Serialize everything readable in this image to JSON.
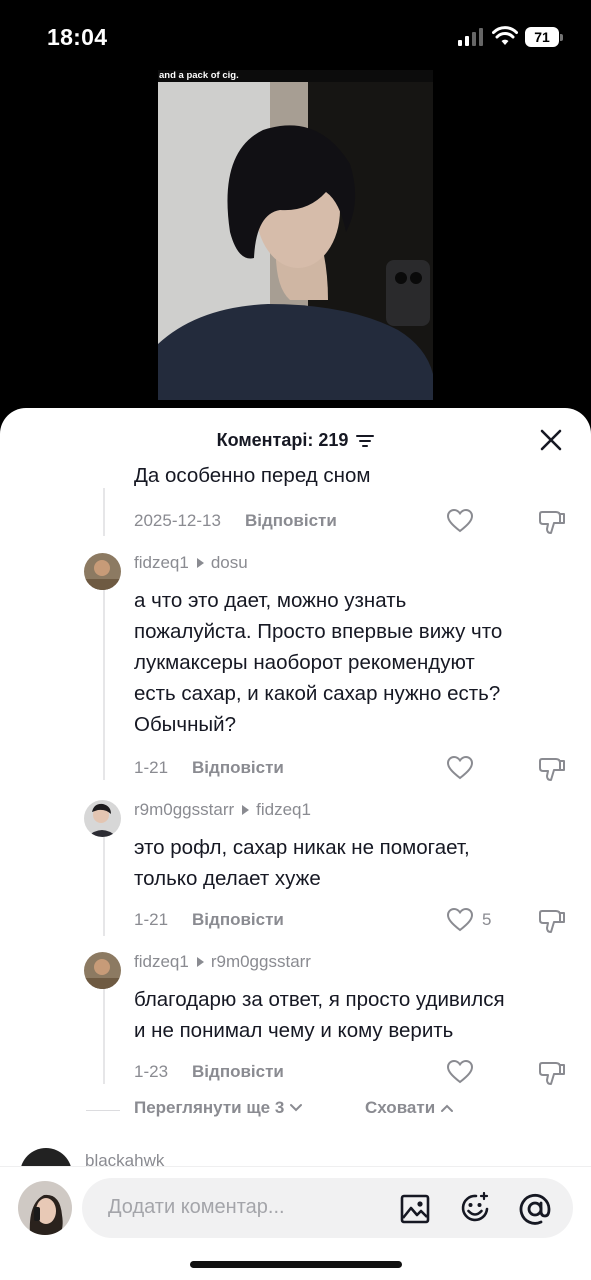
{
  "status_bar": {
    "time": "18:04",
    "battery": "71"
  },
  "video": {
    "caption": "and a pack of cig."
  },
  "comments_header": {
    "title": "Коментарі: 219"
  },
  "first_reply": {
    "text": "Да особенно перед сном",
    "date": "2025-12-13",
    "reply_label": "Відповісти"
  },
  "replies": [
    {
      "author": "fidzeq1",
      "reply_to": "dosu",
      "lines": [
        "а что это дает, можно узнать",
        "пожалуйста. Просто впервые вижу что",
        "лукмаксеры наоборот рекомендуют",
        "есть сахар, и какой сахар нужно есть?",
        "Обычный?"
      ],
      "date": "1-21",
      "reply_label": "Відповісти",
      "likes": ""
    },
    {
      "author": "r9m0ggsstarr",
      "reply_to": "fidzeq1",
      "lines": [
        "это рофл, сахар никак не помогает,",
        "только делает хуже"
      ],
      "date": "1-21",
      "reply_label": "Відповісти",
      "likes": "5"
    },
    {
      "author": "fidzeq1",
      "reply_to": "r9m0ggsstarr",
      "lines": [
        "благодарю за ответ, я просто удивился",
        "и не понимал чему и кому верить"
      ],
      "date": "1-23",
      "reply_label": "Відповісти",
      "likes": ""
    }
  ],
  "thread_controls": {
    "view_more": "Переглянути ще 3",
    "hide": "Сховати"
  },
  "next_comment": {
    "author": "blackahwk"
  },
  "input_bar": {
    "placeholder": "Додати коментар..."
  },
  "icons": {
    "sort": "sort-icon",
    "close": "close-icon",
    "like": "heart-outline-icon",
    "dislike": "thumbs-down-icon",
    "image": "image-icon",
    "emoji": "emoji-icon",
    "mention": "at-icon"
  }
}
